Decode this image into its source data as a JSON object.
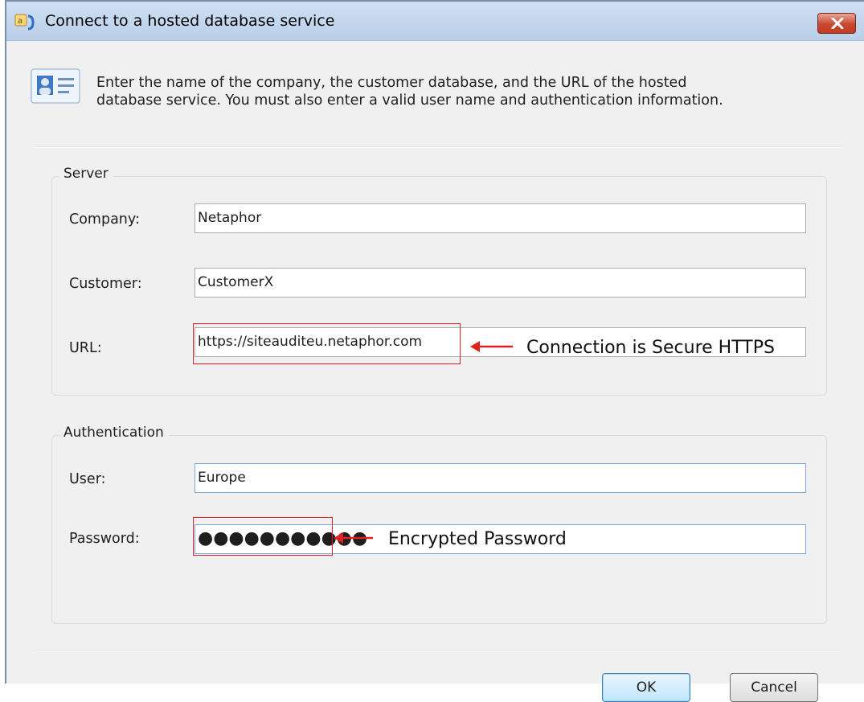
{
  "window": {
    "title": "Connect to a hosted database service",
    "icons": {
      "app": "database-connect-icon",
      "close": "close-icon",
      "info": "contact-card-icon"
    }
  },
  "instructions": {
    "line1": "Enter the name of the company, the customer database, and the URL of the hosted",
    "line2": "database service.  You must also enter a valid user name and authentication information."
  },
  "server": {
    "legend": "Server",
    "company_label": "Company:",
    "company_value": "Netaphor",
    "customer_label": "Customer:",
    "customer_value": "CustomerX",
    "url_label": "URL:",
    "url_value": "https://siteauditeu.netaphor.com"
  },
  "auth": {
    "legend": "Authentication",
    "user_label": "User:",
    "user_value": "Europe",
    "password_label": "Password:",
    "password_mask": "●●●●●●●●●●●"
  },
  "annotations": {
    "url_note": "Connection is Secure HTTPS",
    "password_note": "Encrypted Password",
    "highlight_color": "#e02020"
  },
  "buttons": {
    "ok": "OK",
    "cancel": "Cancel"
  }
}
